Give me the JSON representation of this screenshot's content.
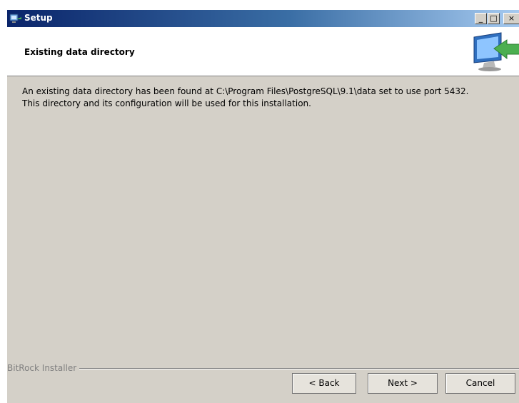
{
  "window": {
    "title": "Setup",
    "controls": {
      "minimize": "_",
      "maximize": "□",
      "close": "×"
    }
  },
  "header": {
    "title": "Existing data directory",
    "graphic_icon": "computer-install-icon"
  },
  "body": {
    "message_line1": "An existing data directory has been found at C:\\Program Files\\PostgreSQL\\9.1\\data set to use port 5432.",
    "message_line2": "This directory and its configuration will be used for this installation."
  },
  "footer": {
    "vendor": "BitRock Installer",
    "back_label": "< Back",
    "next_label": "Next >",
    "cancel_label": "Cancel"
  }
}
